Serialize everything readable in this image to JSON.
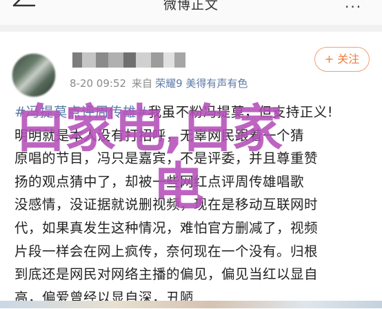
{
  "header": {
    "title": "微博正文",
    "more_label": "···"
  },
  "post": {
    "time": "8-20 09:52",
    "source_prefix": "来自",
    "device": "荣耀9 美得有声有色",
    "follow_label": "+ 关注",
    "lines": [
      {
        "tag": "#冯提莫点评周传雄#",
        "text": "我虽不粉冯提莫，但支持正义!"
      },
      {
        "tag": "",
        "text": "明明就是本人没有打招呼，无辜网民跟着一个猜"
      },
      {
        "tag": "",
        "text": "原唱的节目，冯只是嘉宾，不是评委，并且尊重赞"
      },
      {
        "tag": "",
        "text": "扬的观点猜中了，却被一些网红点评周传雄唱歌"
      },
      {
        "tag": "",
        "text": "没感情，没证据就说删视频，现在是移动互联网时"
      },
      {
        "tag": "",
        "text": "代，如果真发生这种情况，难怕官方删减了，视频"
      },
      {
        "tag": "",
        "text": "片段一样会在网上疯传，奈何现在一个没有。归根"
      },
      {
        "tag": "",
        "text": "到底还是网民对网络主播的偏见，偏见当红以显自"
      },
      {
        "tag": "",
        "text": "高，偏爱曾经以显自深，丑陋"
      }
    ]
  },
  "watermark": {
    "line1": "白家电,白家",
    "line2": "电"
  }
}
